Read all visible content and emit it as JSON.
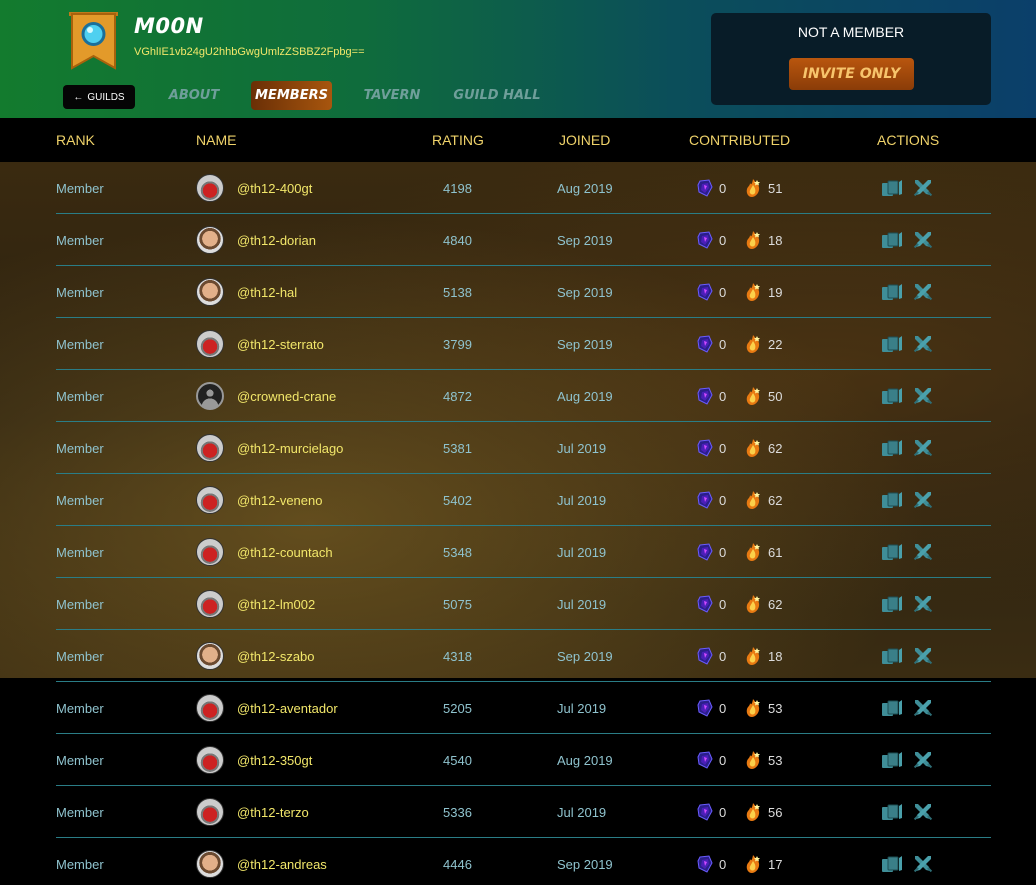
{
  "guild": {
    "name": "M00N",
    "id": "VGhlIE1vb24gU2hhbGwgUmlzZSBBZ2Fpbg==",
    "membership_status": "NOT A MEMBER",
    "invite_label": "INVITE ONLY"
  },
  "nav": {
    "back_label": "GUILDS",
    "tabs": [
      {
        "label": "ABOUT",
        "active": false
      },
      {
        "label": "MEMBERS",
        "active": true
      },
      {
        "label": "TAVERN",
        "active": false
      },
      {
        "label": "GUILD HALL",
        "active": false
      }
    ]
  },
  "table": {
    "headers": {
      "rank": "RANK",
      "name": "NAME",
      "rating": "RATING",
      "joined": "JOINED",
      "contributed": "CONTRIBUTED",
      "actions": "ACTIONS"
    },
    "rows": [
      {
        "rank": "Member",
        "name": "@th12-400gt",
        "rating": "4198",
        "joined": "Aug 2019",
        "gems": "0",
        "embers": "51",
        "avatar": "car"
      },
      {
        "rank": "Member",
        "name": "@th12-dorian",
        "rating": "4840",
        "joined": "Sep 2019",
        "gems": "0",
        "embers": "18",
        "avatar": "face"
      },
      {
        "rank": "Member",
        "name": "@th12-hal",
        "rating": "5138",
        "joined": "Sep 2019",
        "gems": "0",
        "embers": "19",
        "avatar": "face"
      },
      {
        "rank": "Member",
        "name": "@th12-sterrato",
        "rating": "3799",
        "joined": "Sep 2019",
        "gems": "0",
        "embers": "22",
        "avatar": "car"
      },
      {
        "rank": "Member",
        "name": "@crowned-crane",
        "rating": "4872",
        "joined": "Aug 2019",
        "gems": "0",
        "embers": "50",
        "avatar": "default"
      },
      {
        "rank": "Member",
        "name": "@th12-murcielago",
        "rating": "5381",
        "joined": "Jul 2019",
        "gems": "0",
        "embers": "62",
        "avatar": "car"
      },
      {
        "rank": "Member",
        "name": "@th12-veneno",
        "rating": "5402",
        "joined": "Jul 2019",
        "gems": "0",
        "embers": "62",
        "avatar": "car"
      },
      {
        "rank": "Member",
        "name": "@th12-countach",
        "rating": "5348",
        "joined": "Jul 2019",
        "gems": "0",
        "embers": "61",
        "avatar": "car"
      },
      {
        "rank": "Member",
        "name": "@th12-lm002",
        "rating": "5075",
        "joined": "Jul 2019",
        "gems": "0",
        "embers": "62",
        "avatar": "car"
      },
      {
        "rank": "Member",
        "name": "@th12-szabo",
        "rating": "4318",
        "joined": "Sep 2019",
        "gems": "0",
        "embers": "18",
        "avatar": "face"
      },
      {
        "rank": "Member",
        "name": "@th12-aventador",
        "rating": "5205",
        "joined": "Jul 2019",
        "gems": "0",
        "embers": "53",
        "avatar": "car"
      },
      {
        "rank": "Member",
        "name": "@th12-350gt",
        "rating": "4540",
        "joined": "Aug 2019",
        "gems": "0",
        "embers": "53",
        "avatar": "car"
      },
      {
        "rank": "Member",
        "name": "@th12-terzo",
        "rating": "5336",
        "joined": "Jul 2019",
        "gems": "0",
        "embers": "56",
        "avatar": "car"
      },
      {
        "rank": "Member",
        "name": "@th12-andreas",
        "rating": "4446",
        "joined": "Sep 2019",
        "gems": "0",
        "embers": "17",
        "avatar": "face"
      }
    ]
  },
  "colors": {
    "accent_yellow": "#f2e76a",
    "header_text": "#f0d36a",
    "cell_text": "#8fc3ce",
    "separator": "#2a7d86",
    "invite_orange": "#b9560e"
  }
}
